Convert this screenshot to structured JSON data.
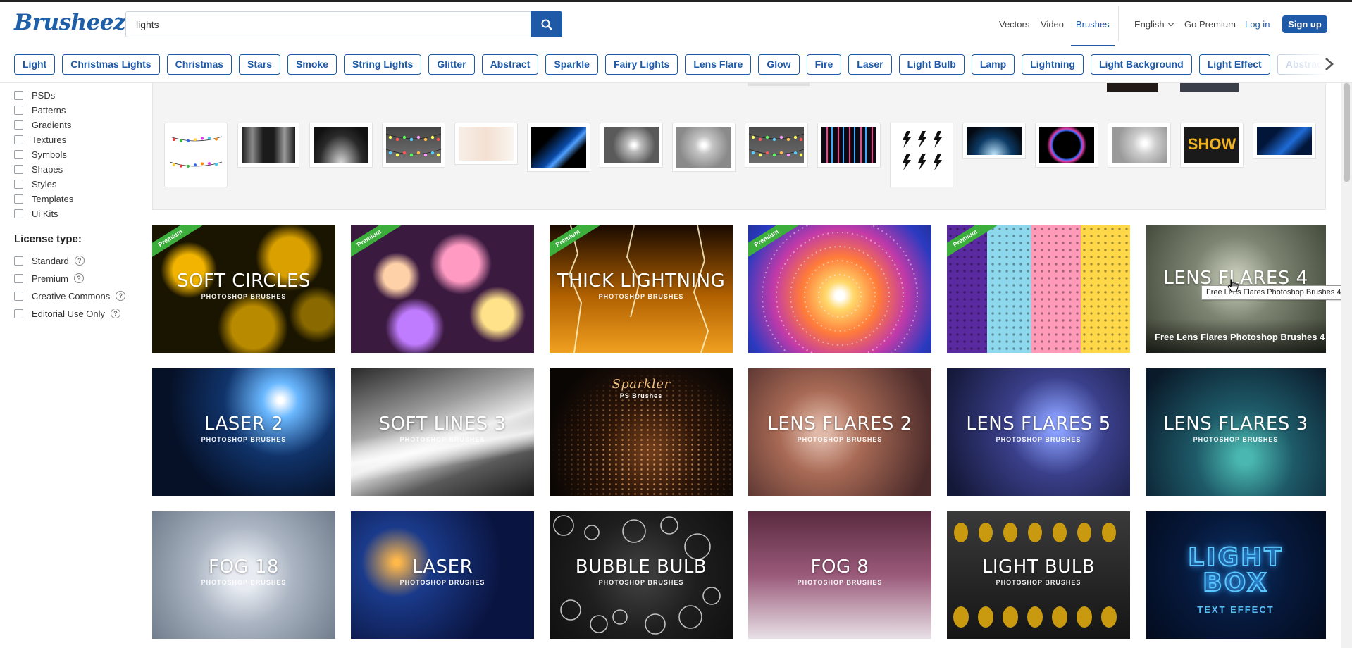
{
  "header": {
    "logo": "Brusheezy",
    "search": {
      "value": "lights"
    },
    "nav": [
      "Vectors",
      "Video",
      "Brushes"
    ],
    "active_nav": "Brushes",
    "language": "English",
    "go_premium": "Go Premium",
    "login": "Log in",
    "signup": "Sign up"
  },
  "tags": [
    "Light",
    "Christmas Lights",
    "Christmas",
    "Stars",
    "Smoke",
    "String Lights",
    "Glitter",
    "Abstract",
    "Sparkle",
    "Fairy Lights",
    "Lens Flare",
    "Glow",
    "Fire",
    "Laser",
    "Light Bulb",
    "Lamp",
    "Lightning",
    "Light Background",
    "Light Effect",
    "Abstract Light"
  ],
  "filters": {
    "types": [
      "PSDs",
      "Patterns",
      "Gradients",
      "Textures",
      "Symbols",
      "Shapes",
      "Styles",
      "Templates",
      "Ui Kits"
    ],
    "license_title": "License type:",
    "licenses": [
      {
        "label": "Standard",
        "help": "?"
      },
      {
        "label": "Premium",
        "help": "?"
      },
      {
        "label": "Creative Commons",
        "help": "?"
      },
      {
        "label": "Editorial Use Only",
        "help": "?"
      }
    ]
  },
  "grid": {
    "ribbon": "Premium",
    "cards": [
      {
        "title": "SOFT CIRCLES",
        "sub": "PHOTOSHOP BRUSHES",
        "premium": true
      },
      {
        "title": "",
        "sub": "",
        "premium": true
      },
      {
        "title": "THICK LIGHTNING",
        "sub": "PHOTOSHOP BRUSHES",
        "premium": true
      },
      {
        "title": "",
        "sub": "",
        "premium": true
      },
      {
        "title": "",
        "sub": "",
        "premium": true
      },
      {
        "title": "LENS FLARES 4",
        "sub": "",
        "premium": false,
        "overlay": "Free Lens Flares Photoshop Brushes 4"
      },
      {
        "title": "LASER 2",
        "sub": "PHOTOSHOP BRUSHES",
        "premium": false
      },
      {
        "title": "SOFT LINES 3",
        "sub": "PHOTOSHOP BRUSHES",
        "premium": false
      },
      {
        "title": "Sparkler",
        "sub": "PS Brushes",
        "premium": false
      },
      {
        "title": "LENS FLARES 2",
        "sub": "PHOTOSHOP BRUSHES",
        "premium": false
      },
      {
        "title": "LENS FLARES 5",
        "sub": "PHOTOSHOP BRUSHES",
        "premium": false
      },
      {
        "title": "LENS FLARES 3",
        "sub": "PHOTOSHOP BRUSHES",
        "premium": false
      },
      {
        "title": "FOG 18",
        "sub": "PHOTOSHOP BRUSHES",
        "premium": false
      },
      {
        "title": "LASER",
        "sub": "PHOTOSHOP BRUSHES",
        "premium": false
      },
      {
        "title": "BUBBLE BULB",
        "sub": "PHOTOSHOP BRUSHES",
        "premium": false
      },
      {
        "title": "FOG 8",
        "sub": "PHOTOSHOP BRUSHES",
        "premium": false
      },
      {
        "title": "LIGHT BULB",
        "sub": "PHOTOSHOP BRUSHES",
        "premium": false
      },
      {
        "title": "LIGHT BOX",
        "sub": "TEXT EFFECT",
        "premium": false
      }
    ]
  },
  "related_thumbs": {
    "show_label": "SHOW"
  },
  "tooltip": "Free Lens Flares Photoshop Brushes 4",
  "colors": {
    "brand": "#1e5aa8",
    "premium_ribbon": "#3cae3c"
  }
}
